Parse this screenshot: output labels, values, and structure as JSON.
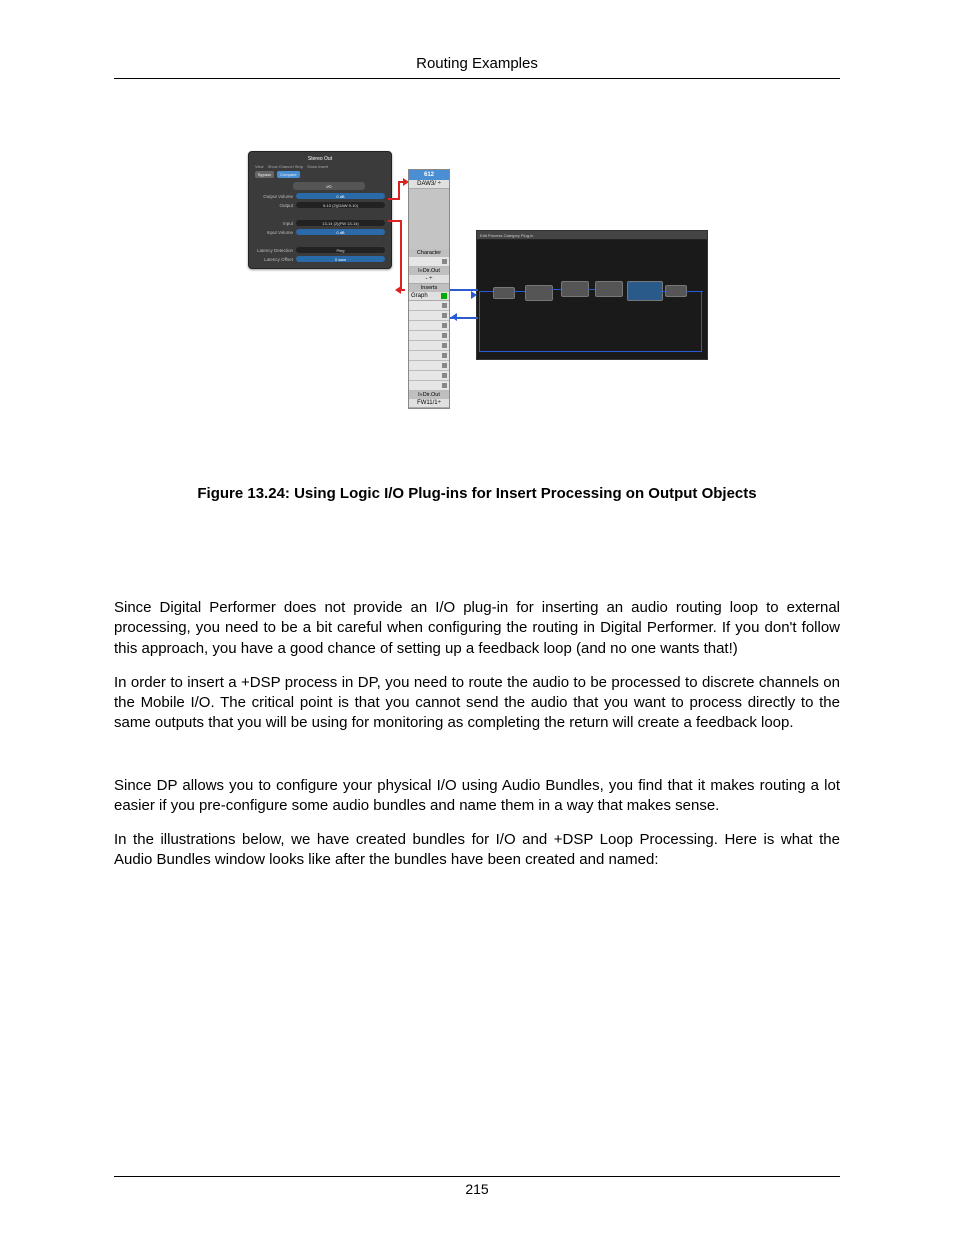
{
  "header": {
    "title": "Routing Examples"
  },
  "figure": {
    "plugin": {
      "title": "Stereo Out",
      "toolbar": [
        "View",
        "Show Channel Strip",
        "Show Insert"
      ],
      "buttons": {
        "bypass": "Bypass",
        "compare": "Compare"
      },
      "section": "I/O",
      "rows": [
        {
          "label": "Output Volume",
          "value": "0 dB",
          "style": "blue"
        },
        {
          "label": "Output",
          "value": "9-10 (2)(DAW 9-10)",
          "style": "dark"
        },
        {
          "label": "Input",
          "value": "13-14 (2)(FW 13-14)",
          "style": "dark"
        },
        {
          "label": "Input Volume",
          "value": "0 dB",
          "style": "blue"
        },
        {
          "label": "Latency Detection",
          "value": "Ping",
          "style": "dark"
        },
        {
          "label": "Latency Offset",
          "value": "0 sam",
          "style": "blue"
        }
      ]
    },
    "strip": {
      "topNum": "612",
      "topRoute": "DAW3/ ÷",
      "character": "Character",
      "dirout1": "I»Dir.Out",
      "dash": "-  ÷",
      "inserts": "Inserts",
      "graph": "Graph",
      "dirout2": "I»Dir.Out",
      "fw": "FW11/1÷"
    },
    "graph": {
      "toolbar": "Edit  Process  Category  Plug-in"
    },
    "caption": "Figure 13.24: Using Logic I/O Plug-ins for Insert Processing on Output Objects"
  },
  "paragraphs": {
    "p1": "Since Digital Performer does not provide an I/O plug-in for inserting an audio routing loop to external processing, you need to be a bit careful when configuring the routing in Digital Performer. If you don't follow this approach, you have a good chance of setting up a feedback loop (and no one wants that!)",
    "p2": "In order to insert a +DSP process in DP, you need to route the audio to be processed to discrete channels on the Mobile I/O. The critical point is that you cannot send the audio that you want to process directly to the same outputs that you will be using for monitoring as completing the return will create a feedback loop.",
    "p3": "Since DP allows you to configure your physical I/O using Audio Bundles, you find that it makes routing a lot easier if you pre-configure some audio bundles and name them in a way that makes sense.",
    "p4": "In the illustrations below, we have created bundles for I/O and +DSP Loop Processing. Here is what the Audio Bundles window looks like after the bundles have been created and named:"
  },
  "footer": {
    "page": "215"
  }
}
